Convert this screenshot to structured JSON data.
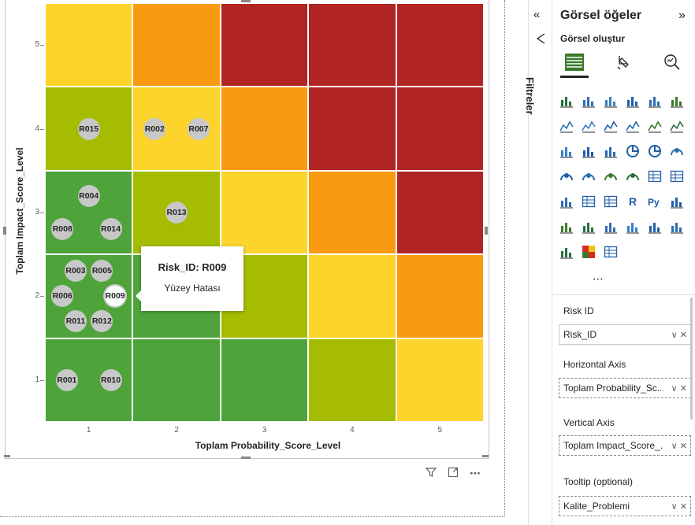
{
  "chart_data": {
    "type": "heatmap",
    "xlabel": "Toplam Probability_Score_Level",
    "ylabel": "Toplam Impact_Score_Level",
    "x_ticks": [
      "1",
      "2",
      "3",
      "4",
      "5"
    ],
    "y_ticks": [
      "5",
      "4",
      "3",
      "2",
      "1"
    ],
    "colors": {
      "dark_green": "#4ea43a",
      "light_green": "#a5bc00",
      "yellow": "#fcd42c",
      "orange": "#fa9a11",
      "red": "#b02424"
    },
    "cells": [
      {
        "prob": 1,
        "impact": 5,
        "color": "yellow"
      },
      {
        "prob": 2,
        "impact": 5,
        "color": "orange"
      },
      {
        "prob": 3,
        "impact": 5,
        "color": "red"
      },
      {
        "prob": 4,
        "impact": 5,
        "color": "red"
      },
      {
        "prob": 5,
        "impact": 5,
        "color": "red"
      },
      {
        "prob": 1,
        "impact": 4,
        "color": "light_green"
      },
      {
        "prob": 2,
        "impact": 4,
        "color": "yellow"
      },
      {
        "prob": 3,
        "impact": 4,
        "color": "orange"
      },
      {
        "prob": 4,
        "impact": 4,
        "color": "red"
      },
      {
        "prob": 5,
        "impact": 4,
        "color": "red"
      },
      {
        "prob": 1,
        "impact": 3,
        "color": "dark_green"
      },
      {
        "prob": 2,
        "impact": 3,
        "color": "light_green"
      },
      {
        "prob": 3,
        "impact": 3,
        "color": "yellow"
      },
      {
        "prob": 4,
        "impact": 3,
        "color": "orange"
      },
      {
        "prob": 5,
        "impact": 3,
        "color": "red"
      },
      {
        "prob": 1,
        "impact": 2,
        "color": "dark_green"
      },
      {
        "prob": 2,
        "impact": 2,
        "color": "dark_green"
      },
      {
        "prob": 3,
        "impact": 2,
        "color": "light_green"
      },
      {
        "prob": 4,
        "impact": 2,
        "color": "yellow"
      },
      {
        "prob": 5,
        "impact": 2,
        "color": "orange"
      },
      {
        "prob": 1,
        "impact": 1,
        "color": "dark_green"
      },
      {
        "prob": 2,
        "impact": 1,
        "color": "dark_green"
      },
      {
        "prob": 3,
        "impact": 1,
        "color": "dark_green"
      },
      {
        "prob": 4,
        "impact": 1,
        "color": "light_green"
      },
      {
        "prob": 5,
        "impact": 1,
        "color": "yellow"
      }
    ],
    "risks": [
      {
        "id": "R015",
        "prob": 1,
        "impact": 4
      },
      {
        "id": "R002",
        "prob": 1.75,
        "impact": 4
      },
      {
        "id": "R007",
        "prob": 2.25,
        "impact": 4
      },
      {
        "id": "R004",
        "prob": 1,
        "impact": 3.2
      },
      {
        "id": "R008",
        "prob": 0.7,
        "impact": 2.8
      },
      {
        "id": "R014",
        "prob": 1.25,
        "impact": 2.8
      },
      {
        "id": "R013",
        "prob": 2,
        "impact": 3
      },
      {
        "id": "R003",
        "prob": 0.85,
        "impact": 2.3
      },
      {
        "id": "R005",
        "prob": 1.15,
        "impact": 2.3
      },
      {
        "id": "R006",
        "prob": 0.7,
        "impact": 2
      },
      {
        "id": "R009",
        "prob": 1.3,
        "impact": 2,
        "active": true
      },
      {
        "id": "R011",
        "prob": 0.85,
        "impact": 1.7
      },
      {
        "id": "R012",
        "prob": 1.15,
        "impact": 1.7
      },
      {
        "id": "R001",
        "prob": 0.75,
        "impact": 1
      },
      {
        "id": "R010",
        "prob": 1.25,
        "impact": 1
      }
    ]
  },
  "tooltip": {
    "title": "Risk_ID: R009",
    "subtitle": "Yüzey Hatası"
  },
  "visual_header_icons": [
    "filter-icon",
    "focus-mode-icon",
    "more-options-icon"
  ],
  "filters_pane": {
    "label": "Filtreler",
    "collapse_glyph": "«"
  },
  "viz_pane": {
    "title": "Görsel öğeler",
    "expand_glyph": "»",
    "subtitle": "Görsel oluştur",
    "more_glyph": "⋯",
    "wells": [
      {
        "label": "Risk ID",
        "value": "Risk_ID"
      },
      {
        "label": "Horizontal Axis",
        "value": "Toplam Probability_Sc..."
      },
      {
        "label": "Vertical Axis",
        "value": "Toplam Impact_Score_..."
      },
      {
        "label": "Tooltip (optional)",
        "value": "Kalite_Problemi"
      }
    ]
  }
}
